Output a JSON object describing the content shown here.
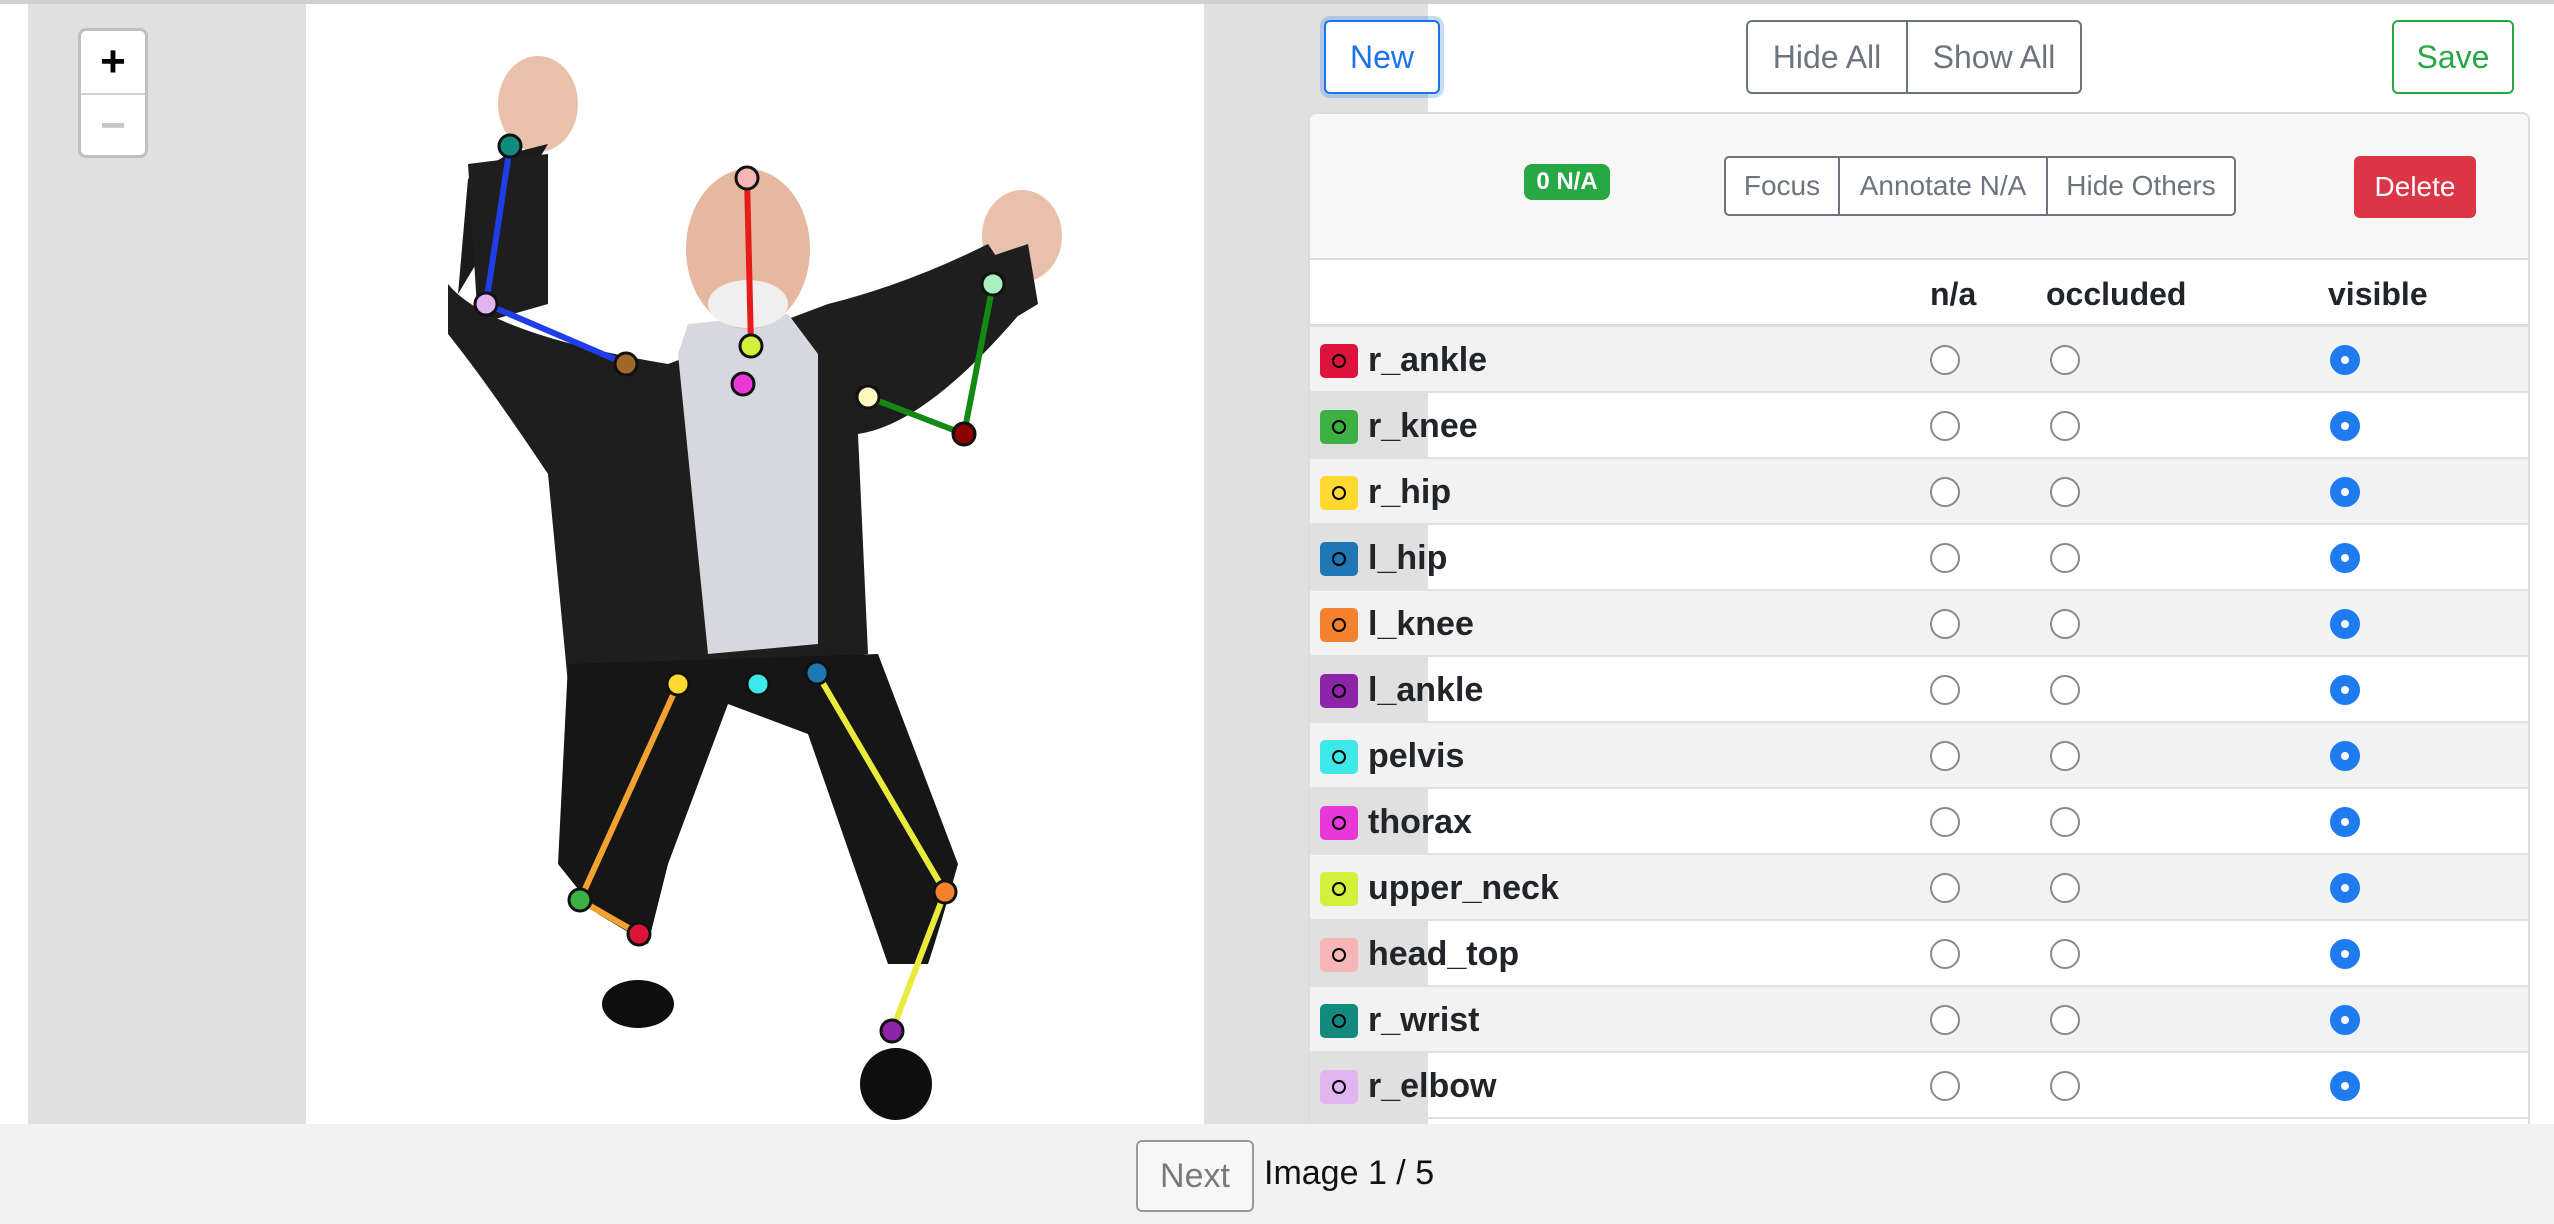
{
  "zoom": {
    "in_label": "+",
    "out_label": "−"
  },
  "toolbar": {
    "new_label": "New",
    "hide_all_label": "Hide All",
    "show_all_label": "Show All",
    "save_label": "Save"
  },
  "annotation": {
    "badge": "0 N/A",
    "focus_label": "Focus",
    "annotate_na_label": "Annotate N/A",
    "hide_others_label": "Hide Others",
    "delete_label": "Delete"
  },
  "table": {
    "headers": {
      "na": "n/a",
      "occluded": "occluded",
      "visible": "visible"
    },
    "rows": [
      {
        "name": "r_ankle",
        "color": "#dc143c",
        "state": "visible"
      },
      {
        "name": "r_knee",
        "color": "#3cb043",
        "state": "visible"
      },
      {
        "name": "r_hip",
        "color": "#ffd92f",
        "state": "visible"
      },
      {
        "name": "l_hip",
        "color": "#1f78b4",
        "state": "visible"
      },
      {
        "name": "l_knee",
        "color": "#f4812d",
        "state": "visible"
      },
      {
        "name": "l_ankle",
        "color": "#8e24aa",
        "state": "visible"
      },
      {
        "name": "pelvis",
        "color": "#3fe8e8",
        "state": "visible"
      },
      {
        "name": "thorax",
        "color": "#e838d8",
        "state": "visible"
      },
      {
        "name": "upper_neck",
        "color": "#d4f03c",
        "state": "visible"
      },
      {
        "name": "head_top",
        "color": "#f7b6b6",
        "state": "visible"
      },
      {
        "name": "r_wrist",
        "color": "#138a7e",
        "state": "visible"
      },
      {
        "name": "r_elbow",
        "color": "#e3b5f0",
        "state": "visible"
      }
    ]
  },
  "footer": {
    "next_label": "Next",
    "image_counter": "Image 1 / 5"
  },
  "colors": {
    "accent": "#1a73e8",
    "success": "#28a745",
    "danger": "#dc3545",
    "radio_selected": "#1e7bf0"
  }
}
